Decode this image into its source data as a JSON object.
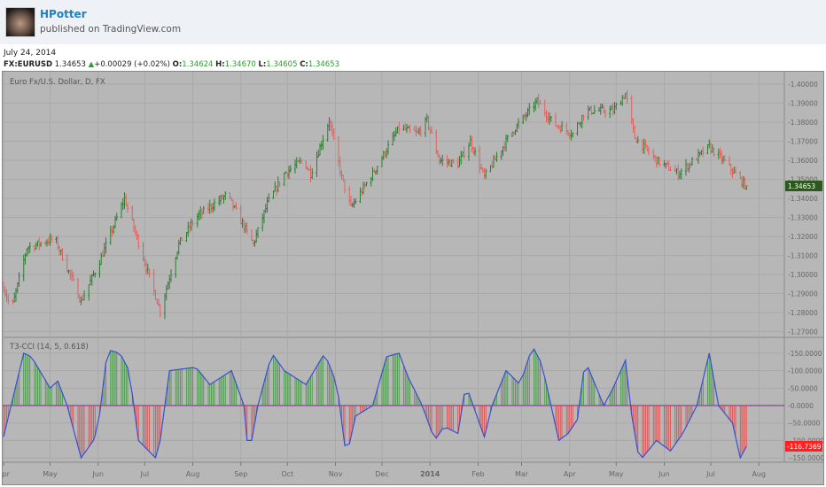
{
  "header": {
    "username": "HPotter",
    "published": "published on TradingView.com"
  },
  "quote": {
    "date": "July 24, 2014",
    "symbol": "FX:EURUSD",
    "last": "1.34653",
    "change": "+0.00029 (+0.02%)",
    "o_label": "O:",
    "o": "1.34624",
    "h_label": "H:",
    "h": "1.34670",
    "l_label": "L:",
    "l": "1.34605",
    "c_label": "C:",
    "c": "1.34653"
  },
  "chart": {
    "title": "Euro Fx/U.S. Dollar, D, FX",
    "indicator_title": "T3-CCI (14, 5, 0.618)"
  },
  "chart_data": [
    {
      "type": "ohlc",
      "name": "EURUSD",
      "x_unit": "days since 2013-04-01",
      "ylim": [
        1.267,
        1.403
      ],
      "price_ticks": [
        "1.40000",
        "1.39000",
        "1.38000",
        "1.37000",
        "1.36000",
        "1.35000",
        "1.34000",
        "1.33000",
        "1.32000",
        "1.31000",
        "1.30000",
        "1.29000",
        "1.28000",
        "1.27000"
      ],
      "last_price_label": "1.34653",
      "close_path": [
        [
          1,
          1.291
        ],
        [
          5,
          1.281
        ],
        [
          15,
          1.314
        ],
        [
          33,
          1.319
        ],
        [
          50,
          1.286
        ],
        [
          61,
          1.305
        ],
        [
          78,
          1.34
        ],
        [
          90,
          1.309
        ],
        [
          101,
          1.281
        ],
        [
          113,
          1.316
        ],
        [
          124,
          1.33
        ],
        [
          144,
          1.342
        ],
        [
          161,
          1.316
        ],
        [
          170,
          1.337
        ],
        [
          181,
          1.353
        ],
        [
          193,
          1.36
        ],
        [
          198,
          1.353
        ],
        [
          210,
          1.381
        ],
        [
          218,
          1.351
        ],
        [
          224,
          1.335
        ],
        [
          238,
          1.353
        ],
        [
          255,
          1.377
        ],
        [
          267,
          1.374
        ],
        [
          273,
          1.381
        ],
        [
          281,
          1.36
        ],
        [
          293,
          1.358
        ],
        [
          301,
          1.37
        ],
        [
          310,
          1.351
        ],
        [
          327,
          1.374
        ],
        [
          344,
          1.391
        ],
        [
          355,
          1.379
        ],
        [
          367,
          1.374
        ],
        [
          375,
          1.386
        ],
        [
          393,
          1.386
        ],
        [
          401,
          1.395
        ],
        [
          407,
          1.372
        ],
        [
          421,
          1.36
        ],
        [
          435,
          1.353
        ],
        [
          455,
          1.367
        ],
        [
          464,
          1.36
        ],
        [
          478,
          1.347
        ],
        [
          479,
          1.3465
        ]
      ]
    },
    {
      "type": "histogram+line",
      "name": "T3-CCI (14, 5, 0.618)",
      "x_unit": "days since 2013-04-01",
      "ylim": [
        -175,
        180
      ],
      "ticks": [
        "150.0000",
        "100.0000",
        "50.0000",
        "0.0000",
        "-50.0000",
        "-100.0000",
        "-150.0000"
      ],
      "last_value_label": "-116.7369",
      "points": [
        [
          0,
          -90
        ],
        [
          13,
          150
        ],
        [
          18,
          140
        ],
        [
          30,
          50
        ],
        [
          35,
          70
        ],
        [
          41,
          0
        ],
        [
          50,
          -150
        ],
        [
          58,
          -100
        ],
        [
          61,
          -60
        ],
        [
          67,
          160
        ],
        [
          75,
          150
        ],
        [
          81,
          100
        ],
        [
          87,
          -100
        ],
        [
          98,
          -150
        ],
        [
          101,
          -100
        ],
        [
          107,
          100
        ],
        [
          124,
          110
        ],
        [
          133,
          60
        ],
        [
          147,
          100
        ],
        [
          155,
          0
        ],
        [
          158,
          -150
        ],
        [
          164,
          0
        ],
        [
          173,
          150
        ],
        [
          181,
          100
        ],
        [
          195,
          60
        ],
        [
          207,
          150
        ],
        [
          215,
          60
        ],
        [
          221,
          -150
        ],
        [
          227,
          -30
        ],
        [
          238,
          0
        ],
        [
          247,
          140
        ],
        [
          255,
          150
        ],
        [
          261,
          80
        ],
        [
          270,
          0
        ],
        [
          278,
          -100
        ],
        [
          284,
          -60
        ],
        [
          293,
          -80
        ],
        [
          298,
          60
        ],
        [
          310,
          -90
        ],
        [
          315,
          0
        ],
        [
          324,
          100
        ],
        [
          333,
          60
        ],
        [
          341,
          170
        ],
        [
          347,
          120
        ],
        [
          358,
          -100
        ],
        [
          364,
          -80
        ],
        [
          370,
          -40
        ],
        [
          375,
          130
        ],
        [
          387,
          0
        ],
        [
          393,
          50
        ],
        [
          401,
          130
        ],
        [
          404,
          0
        ],
        [
          410,
          -160
        ],
        [
          421,
          -100
        ],
        [
          430,
          -130
        ],
        [
          438,
          -80
        ],
        [
          447,
          0
        ],
        [
          455,
          150
        ],
        [
          461,
          0
        ],
        [
          470,
          -50
        ],
        [
          475,
          -150
        ],
        [
          479,
          -117
        ]
      ]
    }
  ],
  "x_axis": {
    "labels": [
      {
        "d": 0,
        "t": "Apr"
      },
      {
        "d": 30,
        "t": "May"
      },
      {
        "d": 61,
        "t": "Jun"
      },
      {
        "d": 91,
        "t": "Jul"
      },
      {
        "d": 122,
        "t": "Aug"
      },
      {
        "d": 153,
        "t": "Sep"
      },
      {
        "d": 183,
        "t": "Oct"
      },
      {
        "d": 214,
        "t": "Nov"
      },
      {
        "d": 244,
        "t": "Dec"
      },
      {
        "d": 275,
        "t": "2014"
      },
      {
        "d": 306,
        "t": "Feb"
      },
      {
        "d": 334,
        "t": "Mar"
      },
      {
        "d": 365,
        "t": "Apr"
      },
      {
        "d": 395,
        "t": "May"
      },
      {
        "d": 426,
        "t": "Jun"
      },
      {
        "d": 456,
        "t": "Jul"
      },
      {
        "d": 487,
        "t": "Aug"
      }
    ]
  },
  "colors": {
    "up": "#2e7d32",
    "down": "#e06060",
    "hist_up": "#3d9a3d",
    "hist_down": "#e04848",
    "line": "#3a4fd0",
    "last_price_bg": "#2b5a1c",
    "last_cci_bg": "#ff2020"
  }
}
